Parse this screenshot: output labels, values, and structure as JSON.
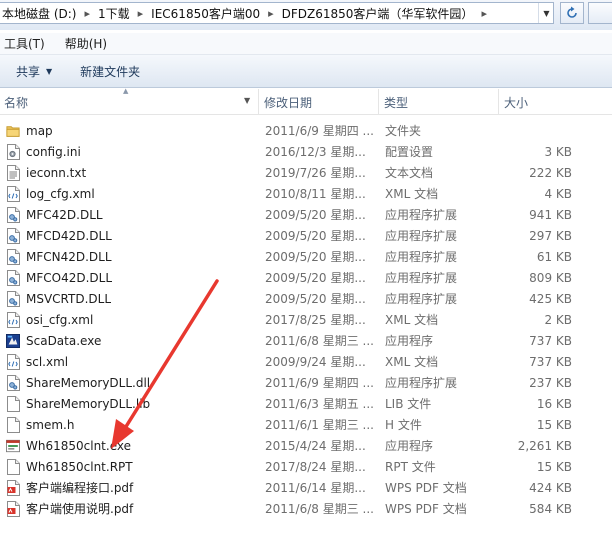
{
  "address": {
    "crumbs": [
      "本地磁盘 (D:)",
      "1下载",
      "IEC61850客户端00",
      "DFDZ61850客户端（华军软件园）"
    ]
  },
  "menu": {
    "tools": "工具(T)",
    "help": "帮助(H)"
  },
  "toolbar": {
    "share": "共享",
    "new_folder": "新建文件夹"
  },
  "columns": {
    "name": "名称",
    "date": "修改日期",
    "type": "类型",
    "size": "大小"
  },
  "files": [
    {
      "name": "map",
      "date": "2011/6/9 星期四 ...",
      "type": "文件夹",
      "size": "",
      "icon": "folder-icon"
    },
    {
      "name": "config.ini",
      "date": "2016/12/3 星期...",
      "type": "配置设置",
      "size": "3 KB",
      "icon": "settings-file-icon"
    },
    {
      "name": "ieconn.txt",
      "date": "2019/7/26 星期...",
      "type": "文本文档",
      "size": "222 KB",
      "icon": "text-file-icon"
    },
    {
      "name": "log_cfg.xml",
      "date": "2010/8/11 星期...",
      "type": "XML 文档",
      "size": "4 KB",
      "icon": "xml-file-icon"
    },
    {
      "name": "MFC42D.DLL",
      "date": "2009/5/20 星期...",
      "type": "应用程序扩展",
      "size": "941 KB",
      "icon": "dll-file-icon"
    },
    {
      "name": "MFCD42D.DLL",
      "date": "2009/5/20 星期...",
      "type": "应用程序扩展",
      "size": "297 KB",
      "icon": "dll-file-icon"
    },
    {
      "name": "MFCN42D.DLL",
      "date": "2009/5/20 星期...",
      "type": "应用程序扩展",
      "size": "61 KB",
      "icon": "dll-file-icon"
    },
    {
      "name": "MFCO42D.DLL",
      "date": "2009/5/20 星期...",
      "type": "应用程序扩展",
      "size": "809 KB",
      "icon": "dll-file-icon"
    },
    {
      "name": "MSVCRTD.DLL",
      "date": "2009/5/20 星期...",
      "type": "应用程序扩展",
      "size": "425 KB",
      "icon": "dll-file-icon"
    },
    {
      "name": "osi_cfg.xml",
      "date": "2017/8/25 星期...",
      "type": "XML 文档",
      "size": "2 KB",
      "icon": "xml-file-icon"
    },
    {
      "name": "ScaData.exe",
      "date": "2011/6/8 星期三 ...",
      "type": "应用程序",
      "size": "737 KB",
      "icon": "app-icon"
    },
    {
      "name": "scl.xml",
      "date": "2009/9/24 星期...",
      "type": "XML 文档",
      "size": "737 KB",
      "icon": "xml-file-icon"
    },
    {
      "name": "ShareMemoryDLL.dll",
      "date": "2011/6/9 星期四 ...",
      "type": "应用程序扩展",
      "size": "237 KB",
      "icon": "dll-file-icon"
    },
    {
      "name": "ShareMemoryDLL.lib",
      "date": "2011/6/3 星期五 ...",
      "type": "LIB 文件",
      "size": "16 KB",
      "icon": "blank-file-icon"
    },
    {
      "name": "smem.h",
      "date": "2011/6/1 星期三 ...",
      "type": "H 文件",
      "size": "15 KB",
      "icon": "blank-file-icon"
    },
    {
      "name": "Wh61850clnt.exe",
      "date": "2015/4/24 星期...",
      "type": "应用程序",
      "size": "2,261 KB",
      "icon": "exe-window-icon"
    },
    {
      "name": "Wh61850clnt.RPT",
      "date": "2017/8/24 星期...",
      "type": "RPT 文件",
      "size": "15 KB",
      "icon": "blank-file-icon"
    },
    {
      "name": "客户端编程接口.pdf",
      "date": "2011/6/14 星期...",
      "type": "WPS PDF 文档",
      "size": "424 KB",
      "icon": "pdf-file-icon"
    },
    {
      "name": "客户端使用说明.pdf",
      "date": "2011/6/8 星期三 ...",
      "type": "WPS PDF 文档",
      "size": "584 KB",
      "icon": "pdf-file-icon"
    }
  ],
  "colors": {
    "arrow": "#e8382f",
    "header_text": "#4c607a",
    "meta_text": "#6d6d6d"
  }
}
